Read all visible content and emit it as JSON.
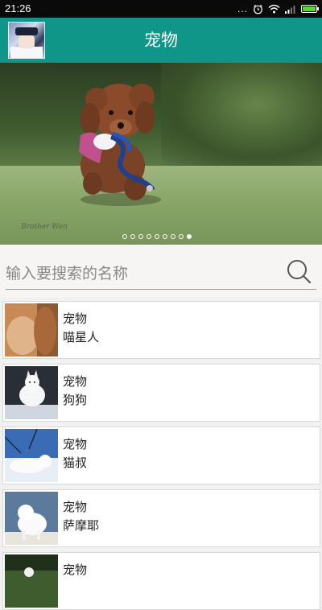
{
  "status_bar": {
    "time": "21:26",
    "dots": "...",
    "icons": [
      "alarm-icon",
      "wifi-icon",
      "signal-icon",
      "battery-icon"
    ],
    "battery_level": 1.0
  },
  "app_bar": {
    "title": "宠物",
    "color": "#0f9688"
  },
  "banner": {
    "watermark": "Brother Wen",
    "page_count": 9,
    "active_page": 8
  },
  "search": {
    "placeholder": "输入要搜索的名称",
    "value": ""
  },
  "items": [
    {
      "title": "宠物",
      "subtitle": "喵星人",
      "thumb": "orange-cat"
    },
    {
      "title": "宠物",
      "subtitle": "狗狗",
      "thumb": "white-fox"
    },
    {
      "title": "宠物",
      "subtitle": "猫叔",
      "thumb": "white-dog-snow"
    },
    {
      "title": "宠物",
      "subtitle": "萨摩耶",
      "thumb": "samoyed"
    },
    {
      "title": "宠物",
      "subtitle": "",
      "thumb": "dog-on-grass"
    }
  ]
}
